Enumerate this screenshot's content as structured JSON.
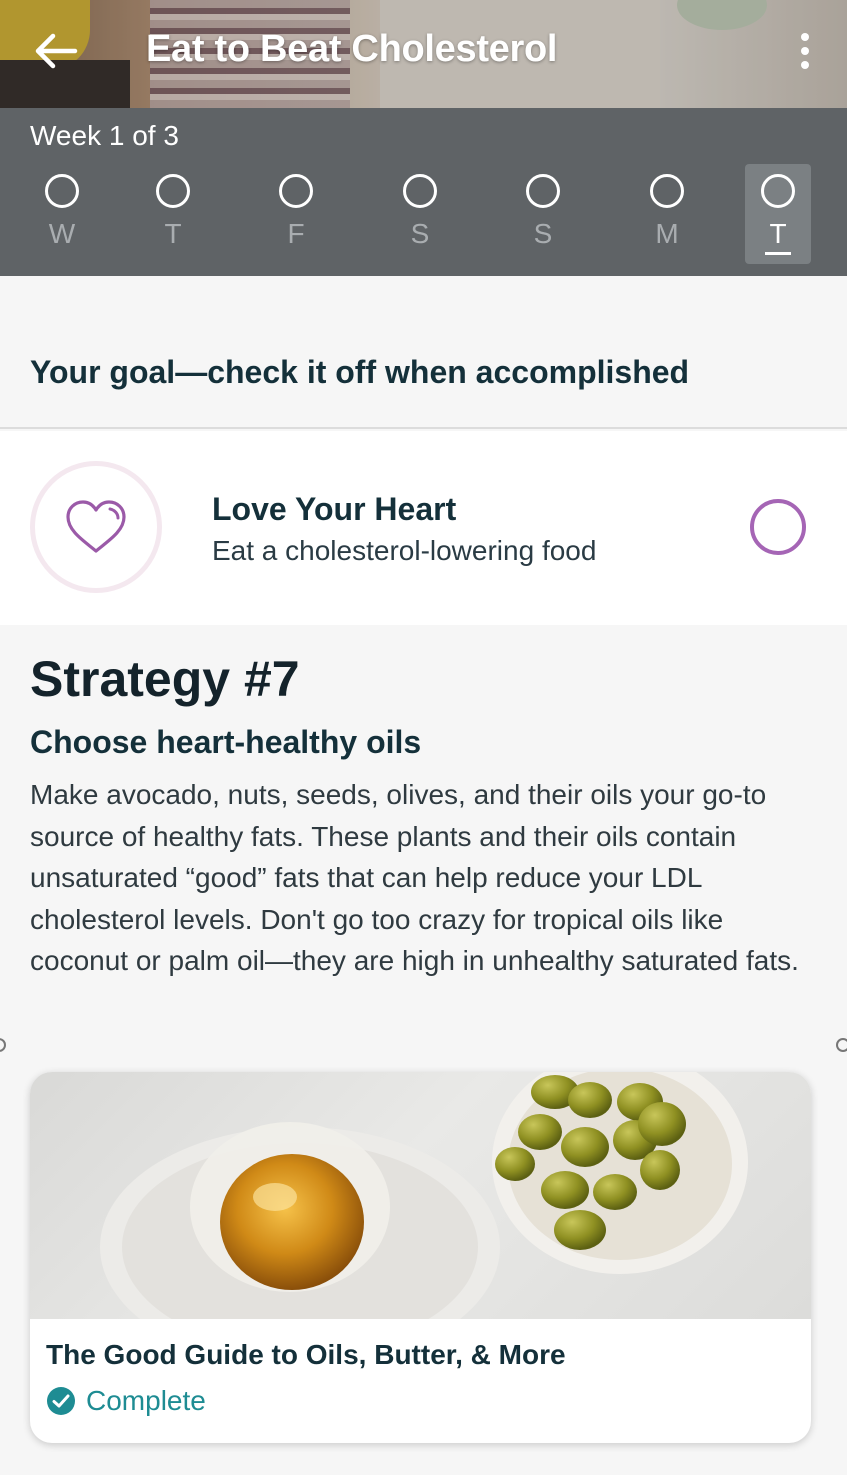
{
  "header": {
    "title": "Eat to Beat Cholesterol",
    "back_icon": "arrow-left-icon",
    "menu_icon": "more-vertical-icon"
  },
  "week": {
    "label": "Week 1 of 3",
    "days": [
      {
        "letter": "W",
        "selected": false
      },
      {
        "letter": "T",
        "selected": false
      },
      {
        "letter": "F",
        "selected": false
      },
      {
        "letter": "S",
        "selected": false
      },
      {
        "letter": "S",
        "selected": false
      },
      {
        "letter": "M",
        "selected": false
      },
      {
        "letter": "T",
        "selected": true
      }
    ]
  },
  "goal": {
    "heading": "Your goal—check it off when accomplished",
    "icon": "heart-icon",
    "title": "Love Your Heart",
    "subtitle": "Eat a cholesterol-lowering food",
    "checked": false
  },
  "strategy": {
    "number": "Strategy #7",
    "title": "Choose heart-healthy oils",
    "body": "Make avocado, nuts, seeds, olives, and their oils your go-to source of healthy fats. These plants and their oils contain unsaturated “good” fats that can help reduce your LDL cholesterol levels. Don't go too crazy for tropical oils like coconut or palm oil—they are high in unhealthy saturated fats."
  },
  "article": {
    "title": "The Good Guide to Oils, Butter, & More",
    "status": "Complete",
    "status_icon": "check-circle-icon"
  },
  "colors": {
    "week_bg": "#5f6366",
    "accent_purple": "#a565b5",
    "complete_teal": "#1e8c93",
    "heading_navy": "#14303a"
  }
}
